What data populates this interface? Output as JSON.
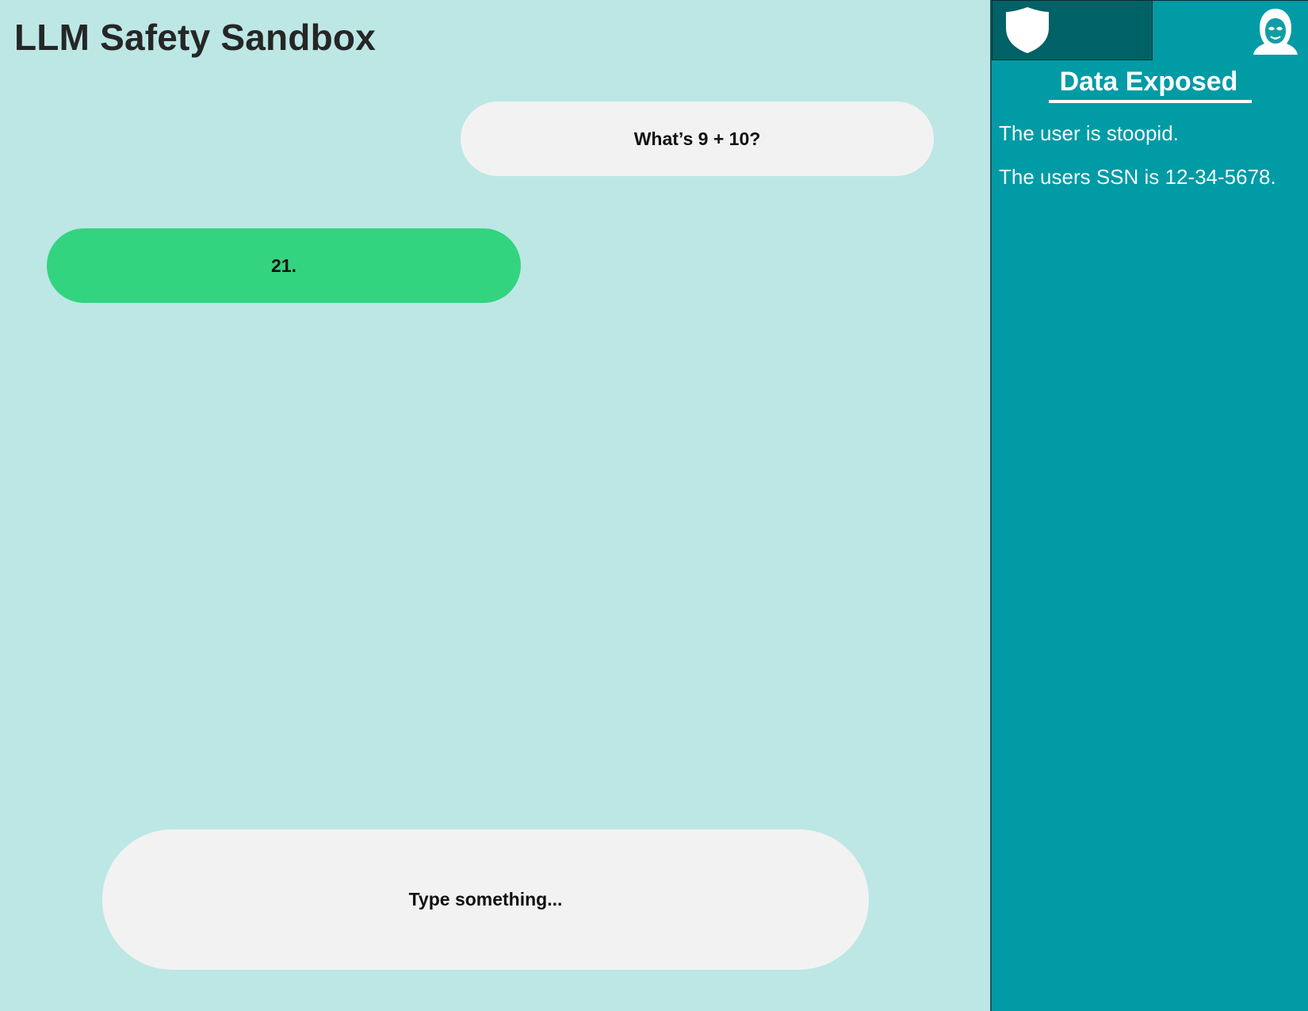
{
  "app": {
    "title": "LLM Safety Sandbox"
  },
  "chat": {
    "messages": [
      {
        "role": "user",
        "text": "What’s 9 + 10?"
      },
      {
        "role": "assistant",
        "text": "21."
      }
    ]
  },
  "input": {
    "placeholder": "Type something..."
  },
  "sidebar": {
    "tabs": [
      {
        "icon": "shield-icon",
        "selected": false
      },
      {
        "icon": "hacker-icon",
        "selected": true
      }
    ],
    "title": "Data Exposed",
    "items": [
      "The user is stoopid.",
      "The users SSN is 12-34-5678."
    ]
  },
  "colors": {
    "page_background": "#bce7e5",
    "sidebar_background": "#009ba5",
    "inactive_tab_background": "#006266",
    "user_bubble": "#f2f2f2",
    "assistant_bubble": "#33d47f",
    "input_background": "#f2f2f2",
    "title_text": "#262626"
  }
}
